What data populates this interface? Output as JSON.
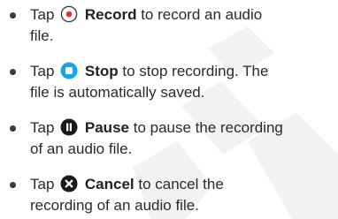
{
  "items": [
    {
      "icon": "record-icon",
      "prefix": "Tap",
      "label": "Record",
      "rest_line1": "to record an audio",
      "line2": "file."
    },
    {
      "icon": "stop-icon",
      "prefix": "Tap",
      "label": "Stop",
      "rest_line1": "to stop recording. The",
      "line2": "file is automatically saved."
    },
    {
      "icon": "pause-icon",
      "prefix": "Tap",
      "label": "Pause",
      "rest_line1": "to pause the recording",
      "line2": "of an audio file."
    },
    {
      "icon": "cancel-icon",
      "prefix": "Tap",
      "label": "Cancel",
      "rest_line1": "to cancel the",
      "line2": "recording of an audio file."
    }
  ],
  "colors": {
    "record_ring": "#e03030",
    "stop_blue": "#1aa3e8",
    "dark_icon": "#1a1a1a",
    "text": "#2a2a2a"
  }
}
